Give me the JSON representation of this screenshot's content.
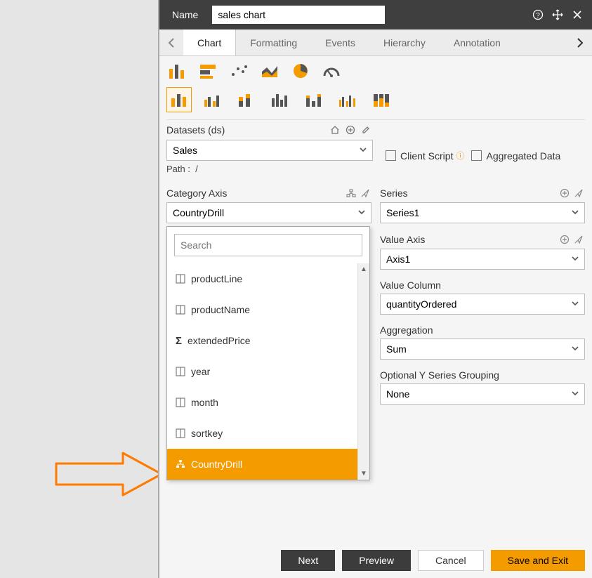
{
  "titlebar": {
    "label": "Name",
    "value": "sales chart",
    "icons": {
      "help": "help-icon",
      "move": "move-icon",
      "close": "close-icon"
    }
  },
  "tabs": {
    "items": [
      "Chart",
      "Formatting",
      "Events",
      "Hierarchy",
      "Annotation"
    ],
    "active": "Chart"
  },
  "chart_types": {
    "row1": [
      "bar-chart-icon",
      "stacked-bar-icon",
      "scatter-icon",
      "area-icon",
      "pie-icon",
      "gauge-icon"
    ],
    "row2": [
      "bar-sub-1-icon",
      "bar-sub-2-icon",
      "bar-sub-3-icon",
      "bar-sub-4-icon",
      "bar-sub-5-icon",
      "bar-sub-6-icon",
      "bar-sub-7-icon"
    ],
    "selected_sub": 0
  },
  "datasets": {
    "label": "Datasets (ds)",
    "value": "Sales",
    "path_label": "Path :",
    "path_value": "/",
    "icons": [
      "home-icon",
      "add-icon",
      "edit-icon"
    ]
  },
  "flags": {
    "client_script": "Client Script",
    "aggregated": "Aggregated Data"
  },
  "left": {
    "category_axis": {
      "label": "Category Axis",
      "value": "CountryDrill",
      "icons": [
        "tree-icon",
        "send-icon"
      ]
    },
    "dropdown": {
      "search_placeholder": "Search",
      "items": [
        {
          "type": "column",
          "label": "productLine"
        },
        {
          "type": "column",
          "label": "productName"
        },
        {
          "type": "sigma",
          "label": "extendedPrice"
        },
        {
          "type": "column",
          "label": "year"
        },
        {
          "type": "column",
          "label": "month"
        },
        {
          "type": "column",
          "label": "sortkey"
        },
        {
          "type": "drill",
          "label": "CountryDrill"
        }
      ],
      "selected_index": 6
    }
  },
  "right": {
    "series": {
      "label": "Series",
      "value": "Series1",
      "icons": [
        "add-icon",
        "send-icon"
      ]
    },
    "value_axis": {
      "label": "Value Axis",
      "value": "Axis1",
      "icons": [
        "add-icon",
        "send-icon"
      ]
    },
    "value_column": {
      "label": "Value Column",
      "value": "quantityOrdered"
    },
    "aggregation": {
      "label": "Aggregation",
      "value": "Sum"
    },
    "grouping": {
      "label": "Optional Y Series Grouping",
      "value": "None"
    }
  },
  "footer": {
    "next": "Next",
    "preview": "Preview",
    "cancel": "Cancel",
    "save": "Save and Exit"
  }
}
